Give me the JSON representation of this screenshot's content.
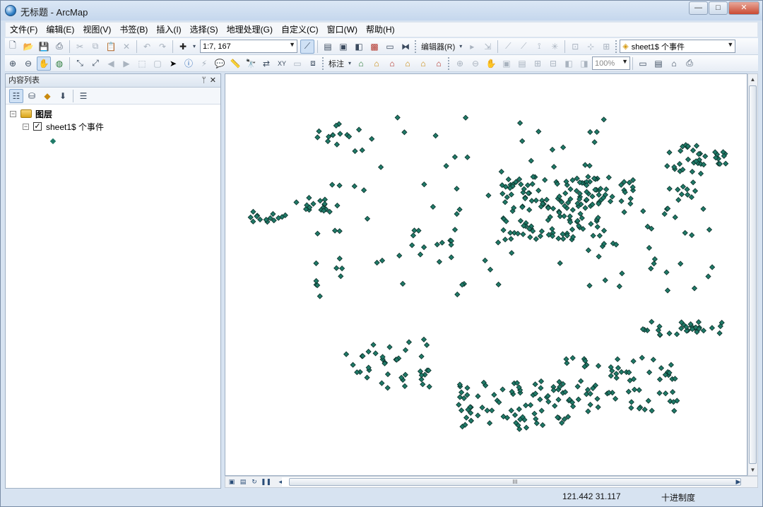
{
  "window": {
    "title": "无标题 - ArcMap",
    "min": "—",
    "max": "□",
    "close": "✕"
  },
  "menu": [
    "文件(F)",
    "编辑(E)",
    "视图(V)",
    "书签(B)",
    "插入(I)",
    "选择(S)",
    "地理处理(G)",
    "自定义(C)",
    "窗口(W)",
    "帮助(H)"
  ],
  "toolbar": {
    "scale": "1:7, 167",
    "editor": "编辑器(R)",
    "layer_combo": "sheet1$ 个事件",
    "label_menu": "标注",
    "zoom": "100%"
  },
  "toc": {
    "title": "内容列表",
    "pin": "ᛘ",
    "close": "✕",
    "root_label": "图层",
    "layer_label": "sheet1$ 个事件",
    "layer_checked": true
  },
  "map": {
    "symbol_color": "#1f7a68",
    "symbol_stroke": "#0b2e27",
    "hscroll_grip": "III"
  },
  "status": {
    "coords": "121.442  31.117",
    "units": "十进制度"
  },
  "icons": {
    "toolbar1": [
      "new-doc-icon",
      "open-folder-icon",
      "save-icon",
      "print-icon",
      "cut-icon",
      "copy-icon",
      "paste-icon",
      "delete-icon",
      "undo-icon",
      "redo-icon",
      "add-data-icon"
    ],
    "toolbar2": [
      "zoom-in-icon",
      "zoom-out-icon",
      "pan-icon",
      "full-extent-icon",
      "fixed-zoom-in-icon",
      "fixed-zoom-out-icon",
      "back-icon",
      "forward-icon",
      "select-features-icon",
      "clear-selection-icon",
      "select-elements-icon",
      "identify-icon",
      "hyperlink-icon",
      "html-popup-icon",
      "measure-icon",
      "find-icon",
      "find-route-icon",
      "goto-xy-icon"
    ]
  }
}
